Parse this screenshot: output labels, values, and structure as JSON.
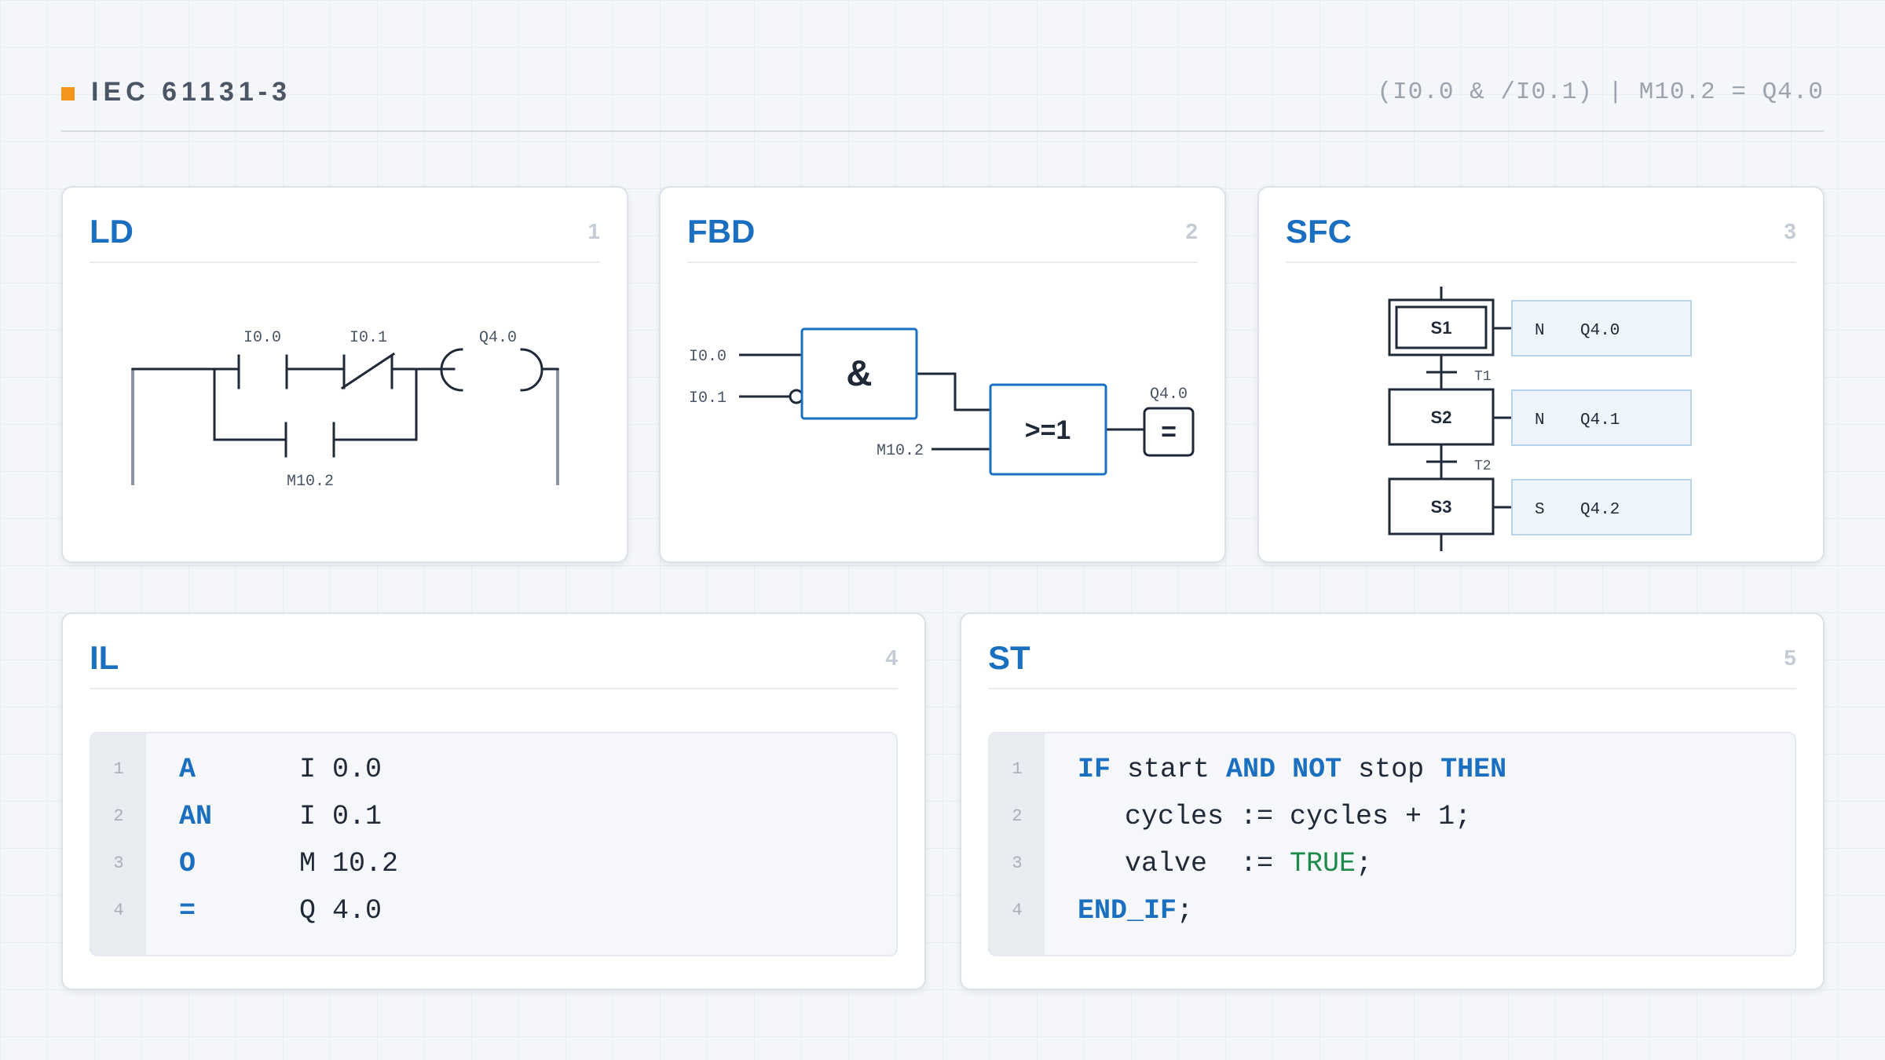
{
  "header": {
    "brand": "IEC 61131-3",
    "formula": "(I0.0 & /I0.1) | M10.2 = Q4.0"
  },
  "cards": {
    "ld": {
      "title": "LD",
      "num": "1",
      "labels": {
        "c1": "I0.0",
        "c2": "I0.1",
        "coil": "Q4.0",
        "branch": "M10.2"
      }
    },
    "fbd": {
      "title": "FBD",
      "num": "2",
      "labels": {
        "in1": "I0.0",
        "in2": "I0.1",
        "in3": "M10.2",
        "and": "&",
        "or": ">=1",
        "out": "Q4.0",
        "assign": "="
      }
    },
    "sfc": {
      "title": "SFC",
      "num": "3",
      "steps": [
        "S1",
        "S2",
        "S3"
      ],
      "transitions": [
        "T1",
        "T2"
      ],
      "actions": [
        {
          "qualifier": "N",
          "var": "Q4.0"
        },
        {
          "qualifier": "N",
          "var": "Q4.1"
        },
        {
          "qualifier": "S",
          "var": "Q4.2"
        }
      ]
    },
    "il": {
      "title": "IL",
      "num": "4",
      "lines": [
        {
          "n": "1",
          "op": "A",
          "arg": "I 0.0"
        },
        {
          "n": "2",
          "op": "AN",
          "arg": "I 0.1"
        },
        {
          "n": "3",
          "op": "O",
          "arg": "M 10.2"
        },
        {
          "n": "4",
          "op": "=",
          "arg": "Q 4.0"
        }
      ]
    },
    "st": {
      "title": "ST",
      "num": "5",
      "lines": [
        {
          "n": "1",
          "kw_if": "IF",
          "t1": " start ",
          "kw_and": "AND",
          "sp1": " ",
          "kw_not": "NOT",
          "t2": " stop ",
          "kw_then": "THEN"
        },
        {
          "n": "2",
          "text": "cycles := cycles + 1;"
        },
        {
          "n": "3",
          "t1": "valve  := ",
          "lit": "TRUE",
          "t2": ";"
        },
        {
          "n": "4",
          "kw_end": "END_IF",
          "t1": ";"
        }
      ]
    }
  }
}
